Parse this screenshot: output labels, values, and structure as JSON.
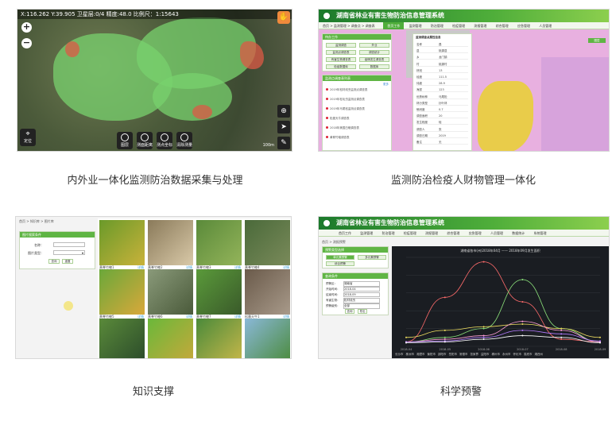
{
  "captions": [
    "内外业一体化监测防治数据采集与处理",
    "监测防治检疫人财物管理一体化",
    "知识支撑",
    "科学预警"
  ],
  "map_tile": {
    "status_bar": "X:116.262  Y:39.905   卫星层:0/4    精度:48.0   比例尺：1:15643",
    "zoom_in": "+",
    "zoom_out": "−",
    "bottom_tools": [
      "图层",
      "测面距离",
      "测点坐标",
      "清除测量"
    ],
    "locate_label": "定位",
    "scale_text": "100m"
  },
  "system_header": {
    "title": "湖南省林业有害生物防治信息管理系统",
    "nav_top_right": [
      "首页",
      "监测",
      "防治",
      "检疫",
      "测报",
      "统计",
      "综合"
    ],
    "nav": [
      "首页工作",
      "监测管理",
      "防治管理",
      "检疫管理",
      "测报管理",
      "综合管理",
      "应急管理",
      "人员管理",
      "数据统计",
      "系统管理"
    ]
  },
  "tile2": {
    "breadcrumb": "首页 > 监测管理 > 调查点 > 调查表",
    "panel_work": "待办工作",
    "work_buttons": [
      "监测调查",
      "外业",
      "监测点调查表",
      "调查统计",
      "有害生物调查表",
      "疫情发生调查表",
      "检疫数据库",
      "数据库"
    ],
    "panel_list": "监测点调查表列表",
    "list_link": "更多",
    "list_items": [
      "2019年松材线虫监测点调查表",
      "2019年松毛虫监测点调查表",
      "2019年马尾松监测点调查表",
      "松墨天牛调查表",
      "2018年美国白蛾调查表",
      "黄脊竹蝗调查表"
    ],
    "attr_title": "监测调查点属性信息",
    "attr_rows": [
      [
        "名称",
        "昌"
      ],
      [
        "县",
        "桃源县"
      ],
      [
        "乡",
        "龙门镇"
      ],
      [
        "村",
        "桃源村"
      ],
      [
        "林班",
        "13"
      ],
      [
        "经度",
        "111.5"
      ],
      [
        "纬度",
        "28.9"
      ],
      [
        "海拔",
        "123"
      ],
      [
        "优势树种",
        "马尾松"
      ],
      [
        "林分类型",
        "针叶林"
      ],
      [
        "郁闭度",
        "0.7"
      ],
      [
        "调查面积",
        "20"
      ],
      [
        "发生程度",
        "轻"
      ],
      [
        "调查人",
        "张"
      ],
      [
        "调查日期",
        "2019"
      ],
      [
        "备注",
        "无"
      ]
    ],
    "side_button": "图层"
  },
  "tile3": {
    "breadcrumb": "首页 > 知识库 > 图片库",
    "panel_title": "图片搜索条件",
    "field_labels": [
      "名称：",
      "图片类型："
    ],
    "select_value": "",
    "buttons": [
      "查询",
      "重置"
    ],
    "photos": [
      {
        "label": "黄脊竹蝗1",
        "colors": [
          "#6a9a2a",
          "#c9b23a"
        ]
      },
      {
        "label": "黄脊竹蝗2",
        "colors": [
          "#8a7a5a",
          "#d9c9a8"
        ]
      },
      {
        "label": "黄脊竹蝗3",
        "colors": [
          "#5a8a3a",
          "#94b45a"
        ]
      },
      {
        "label": "黄脊竹蝗4",
        "colors": [
          "#4a6a3a",
          "#7a8a5a"
        ]
      },
      {
        "label": "黄脊竹蝗5",
        "colors": [
          "#6aa83a",
          "#d9a83a"
        ]
      },
      {
        "label": "黄脊竹蝗6",
        "colors": [
          "#8a9a7a",
          "#4a5a3a"
        ]
      },
      {
        "label": "黄脊竹蝗7",
        "colors": [
          "#5a9a3a",
          "#3a5a2a"
        ]
      },
      {
        "label": "松墨天牛1",
        "colors": [
          "#6a5a4a",
          "#a89a8a"
        ]
      },
      {
        "label": "黄脊竹蝗8",
        "colors": [
          "#5a8a3a",
          "#2a4a2a"
        ]
      },
      {
        "label": "黄脊竹蝗9",
        "colors": [
          "#6ab83a",
          "#c8a83a"
        ]
      },
      {
        "label": "黄脊竹蝗10",
        "colors": [
          "#4a8a3a",
          "#c9b84a"
        ]
      },
      {
        "label": "松材线虫1",
        "colors": [
          "#8ab8d8",
          "#4a8a3a"
        ]
      }
    ],
    "photo_action": "详情"
  },
  "tile4": {
    "breadcrumb": "首页 > 测报预警",
    "panel1_title": "预警类型选择",
    "panel1_buttons": [
      "单元素预警",
      "多元素预警",
      "综合预警"
    ],
    "panel2_title": "查询条件",
    "form_rows": [
      [
        "预警区：",
        "湖南省"
      ],
      [
        "开始时间：",
        "2018-04"
      ],
      [
        "结束时间：",
        "2018-09"
      ],
      [
        "有害生物：",
        "松材线虫"
      ],
      [
        "预警级别：",
        "全部"
      ]
    ],
    "form_buttons": [
      "查询",
      "导出"
    ],
    "chart_title": "湖南省各市(州)2018年04月 —— 2018年09月发生面积",
    "legend": [
      "长沙市",
      "株洲市",
      "湘潭市",
      "衡阳市",
      "邵阳市",
      "岳阳市",
      "常德市",
      "张家界",
      "益阳市",
      "郴州市",
      "永州市",
      "怀化市",
      "娄底市",
      "湘西州"
    ]
  },
  "chart_data": {
    "type": "line",
    "title": "湖南省各市(州)2018年04月 —— 2018年09月发生面积",
    "x": [
      "2018-04",
      "2018-05",
      "2018-06",
      "2018-07",
      "2018-08",
      "2018-09"
    ],
    "series": [
      {
        "name": "长沙市",
        "color": "#ff6b6b",
        "values": [
          0.05,
          0.55,
          0.95,
          0.5,
          0.08,
          0.05
        ]
      },
      {
        "name": "株洲市",
        "color": "#8be07a",
        "values": [
          0.05,
          0.1,
          0.2,
          0.75,
          0.2,
          0.05
        ]
      },
      {
        "name": "湘潭市",
        "color": "#f0e060",
        "values": [
          0.1,
          0.18,
          0.22,
          0.25,
          0.2,
          0.1
        ]
      },
      {
        "name": "衡阳市",
        "color": "#ff9ed8",
        "values": [
          0.05,
          0.08,
          0.12,
          0.28,
          0.18,
          0.05
        ]
      },
      {
        "name": "邵阳市",
        "color": "#b37bff",
        "values": [
          0.05,
          0.06,
          0.1,
          0.18,
          0.14,
          0.06
        ]
      },
      {
        "name": "岳阳市",
        "color": "#ffffff",
        "values": [
          0.04,
          0.05,
          0.08,
          0.12,
          0.1,
          0.04
        ]
      }
    ],
    "ylim": [
      0,
      1
    ]
  },
  "colors": {
    "system_green": "#4fae3a",
    "map_green": "#78d26e",
    "map_red": "#dc5a46",
    "orange": "#f08a3c"
  }
}
